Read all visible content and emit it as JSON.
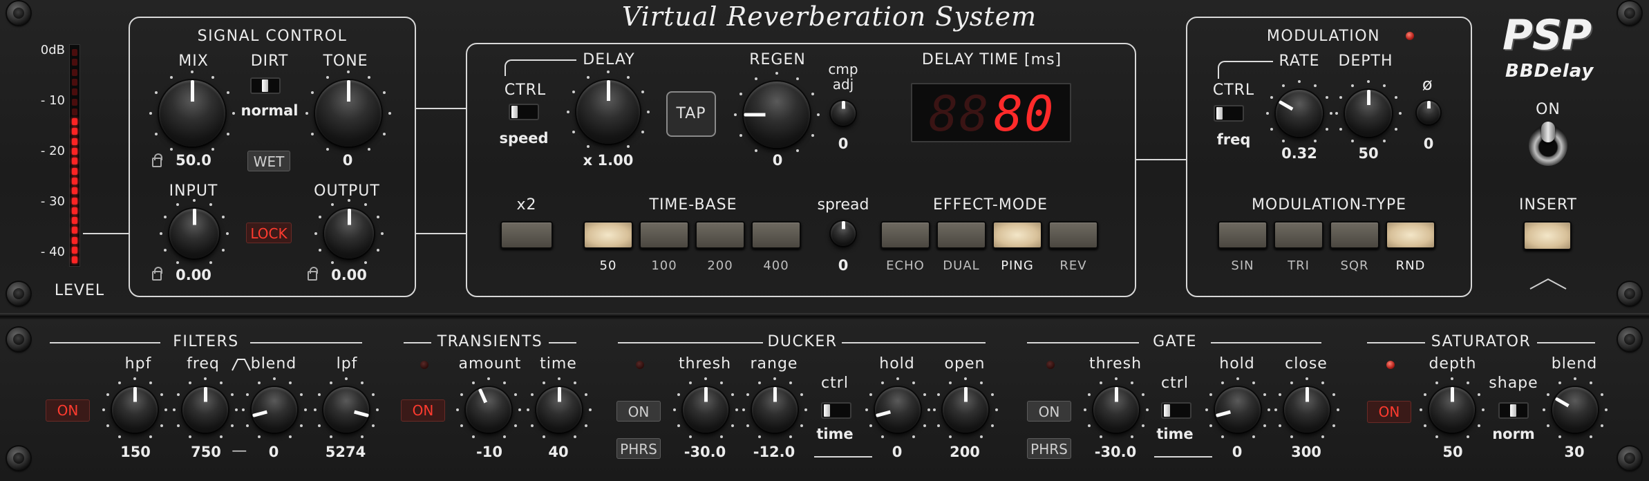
{
  "header": {
    "system_title": "Virtual Reverberation System",
    "brand": "PSP",
    "product": "BBDelay"
  },
  "meter": {
    "labels": [
      "0dB",
      "- 10",
      "- 20",
      "- 30",
      "- 40"
    ],
    "title": "LEVEL",
    "lit_leds": 15,
    "total_leds": 22
  },
  "signal_control": {
    "title": "SIGNAL CONTROL",
    "mix": {
      "label": "MIX",
      "value": "50.0",
      "pos": 0.5
    },
    "dirt": {
      "label": "DIRT",
      "value": "normal"
    },
    "tone": {
      "label": "TONE",
      "value": "0",
      "pos": 0.5
    },
    "wet_label": "WET",
    "input": {
      "label": "INPUT",
      "value": "0.00",
      "pos": 0.5
    },
    "lock_label": "LOCK",
    "output": {
      "label": "OUTPUT",
      "value": "0.00",
      "pos": 0.5
    }
  },
  "delay": {
    "ctrl_label": "CTRL",
    "ctrl_value": "speed",
    "delay_label": "DELAY",
    "delay_value": "x 1.00",
    "delay_pos": 0.5,
    "tap_label": "TAP",
    "regen_label": "REGEN",
    "regen_value": "0",
    "regen_pos": 0.2,
    "cmp_label": [
      "cmp",
      "adj"
    ],
    "cmp_value": "0",
    "cmp_pos": 0.5,
    "time_title": "DELAY TIME [ms]",
    "time_display": "80",
    "x2_label": "x2",
    "timebase_title": "TIME-BASE",
    "timebase": [
      "50",
      "100",
      "200",
      "400"
    ],
    "timebase_active": 0,
    "spread_label": "spread",
    "spread_value": "0",
    "spread_pos": 0.5,
    "effect_title": "EFFECT-MODE",
    "effect": [
      "ECHO",
      "DUAL",
      "PING",
      "REV"
    ],
    "effect_active": 2
  },
  "modulation": {
    "title": "MODULATION",
    "ctrl_label": "CTRL",
    "ctrl_value": "freq",
    "rate_label": "RATE",
    "rate_value": "0.32",
    "rate_pos": 0.3,
    "depth_label": "DEPTH",
    "depth_value": "50",
    "depth_pos": 0.5,
    "phase_label": "ø",
    "phase_value": "0",
    "phase_pos": 0.5,
    "type_title": "MODULATION-TYPE",
    "types": [
      "SIN",
      "TRI",
      "SQR",
      "RND"
    ],
    "type_active": 3
  },
  "power": {
    "on_label": "ON",
    "insert_label": "INSERT"
  },
  "filters": {
    "title": "FILTERS",
    "on_label": "ON",
    "hpf": {
      "label": "hpf",
      "value": "150",
      "pos": 0.5
    },
    "freq": {
      "label": "freq",
      "value": "750",
      "pos": 0.5
    },
    "blend": {
      "label": "blend",
      "value": "0",
      "pos": 0.15
    },
    "lpf": {
      "label": "lpf",
      "value": "5274",
      "pos": 0.85
    },
    "dash": "—"
  },
  "transients": {
    "title": "TRANSIENTS",
    "on_label": "ON",
    "amount": {
      "label": "amount",
      "value": "-10",
      "pos": 0.42
    },
    "time": {
      "label": "time",
      "value": "40",
      "pos": 0.5
    }
  },
  "ducker": {
    "title": "DUCKER",
    "on_label": "ON",
    "phrs_label": "PHRS",
    "thresh": {
      "label": "thresh",
      "value": "-30.0",
      "pos": 0.5
    },
    "range": {
      "label": "range",
      "value": "-12.0",
      "pos": 0.5
    },
    "ctrl_label": "ctrl",
    "ctrl_value": "time",
    "hold": {
      "label": "hold",
      "value": "0",
      "pos": 0.15
    },
    "open": {
      "label": "open",
      "value": "200",
      "pos": 0.5
    }
  },
  "gate": {
    "title": "GATE",
    "on_label": "ON",
    "phrs_label": "PHRS",
    "thresh": {
      "label": "thresh",
      "value": "-30.0",
      "pos": 0.5
    },
    "ctrl_label": "ctrl",
    "ctrl_value": "time",
    "hold": {
      "label": "hold",
      "value": "0",
      "pos": 0.15
    },
    "close": {
      "label": "close",
      "value": "300",
      "pos": 0.5
    }
  },
  "saturator": {
    "title": "SATURATOR",
    "on_label": "ON",
    "depth": {
      "label": "depth",
      "value": "50",
      "pos": 0.5
    },
    "shape_label": "shape",
    "shape_value": "norm",
    "blend": {
      "label": "blend",
      "value": "30",
      "pos": 0.3
    }
  }
}
